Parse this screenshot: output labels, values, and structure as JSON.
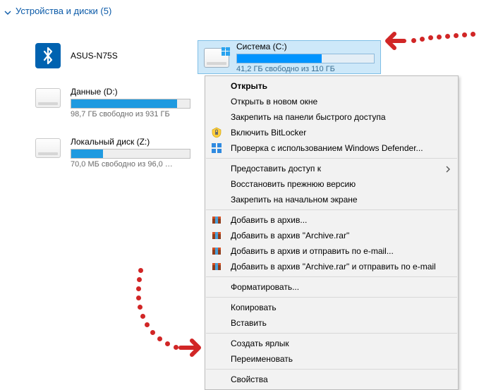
{
  "group": {
    "title": "Устройства и диски (5)"
  },
  "devices": {
    "bluetooth": {
      "label": "ASUS-N75S"
    },
    "dataD": {
      "label": "Данные (D:)",
      "sub": "98,7 ГБ свободно из 931 ГБ",
      "fill_pct": 89
    },
    "localZ": {
      "label": "Локальный диск (Z:)",
      "sub": "70,0 МБ свободно из 96,0 …",
      "fill_pct": 27
    },
    "systemC": {
      "label": "Система (C:)",
      "sub": "41,2 ГБ свободно из 110 ГБ",
      "fill_pct": 62
    }
  },
  "menu": {
    "open": "Открыть",
    "open_new": "Открыть в новом окне",
    "pin_quick": "Закрепить на панели быстрого доступа",
    "bitlocker": "Включить BitLocker",
    "defender": "Проверка с использованием Windows Defender...",
    "share": "Предоставить доступ к",
    "restore": "Восстановить прежнюю версию",
    "pin_start": "Закрепить на начальном экране",
    "rar_add": "Добавить в архив...",
    "rar_add_named": "Добавить в архив \"Archive.rar\"",
    "rar_email": "Добавить в архив и отправить по e-mail...",
    "rar_named_email": "Добавить в архив \"Archive.rar\" и отправить по e-mail",
    "format": "Форматировать...",
    "copy": "Копировать",
    "paste": "Вставить",
    "shortcut": "Создать ярлык",
    "rename": "Переименовать",
    "properties": "Свойства"
  }
}
